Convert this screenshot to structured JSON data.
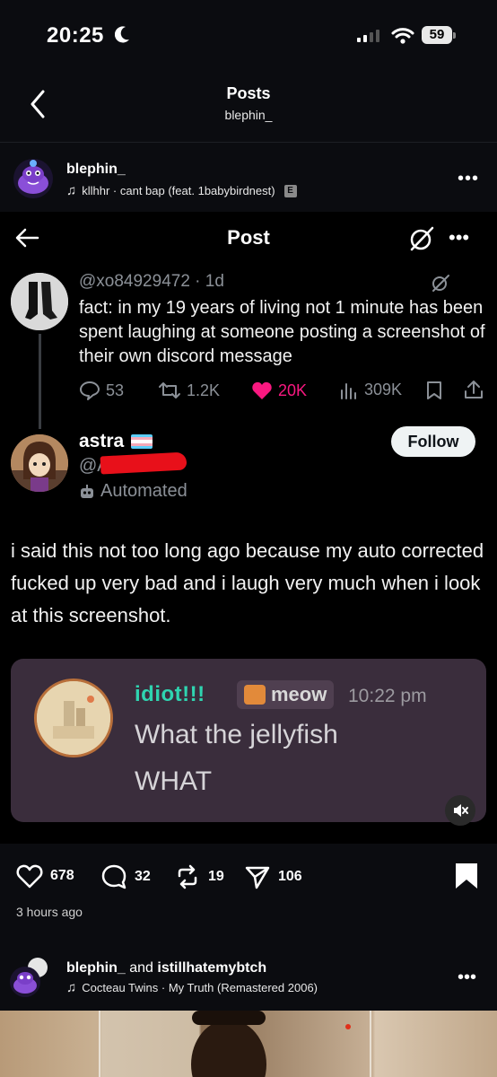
{
  "status_bar": {
    "time": "20:25",
    "battery": "59"
  },
  "header": {
    "title": "Posts",
    "subtitle": "blephin_"
  },
  "post": {
    "username": "blephin_",
    "music": "kllhhr · cant bap (feat. 1babybirdnest)",
    "explicit_badge": "E"
  },
  "screenshot": {
    "title": "Post",
    "quoted": {
      "handle": "@xo84929472 · 1d",
      "text": "fact: in my 19 years of living not 1 minute has been spent laughing at someone posting a screenshot of their own discord message",
      "replies": "53",
      "retweets": "1.2K",
      "likes": "20K",
      "views": "309K"
    },
    "reply": {
      "name": "astra",
      "handle_prefix": "@A",
      "automated": "Automated",
      "follow_label": "Follow",
      "text": "i said this not too long ago because my auto corrected fucked up very bad and i laugh very much when i look at this screenshot."
    },
    "discord": {
      "name": "idiot!!!",
      "tag": "meow",
      "time": "10:22 pm",
      "line1": "What the jellyfish",
      "line2": "WHAT"
    }
  },
  "actions": {
    "likes": "678",
    "comments": "32",
    "reposts": "19",
    "shares": "106"
  },
  "post_time": "3 hours ago",
  "next_post": {
    "user1": "blephin_",
    "joiner": " and ",
    "user2": "istillhatemybtch",
    "music": "Cocteau Twins · My Truth (Remastered 2006)"
  },
  "colors": {
    "like_pink": "#f91880",
    "discord_name": "#2fd4b0",
    "follow_bg": "#eff3f4",
    "redaction": "#e8101a"
  }
}
